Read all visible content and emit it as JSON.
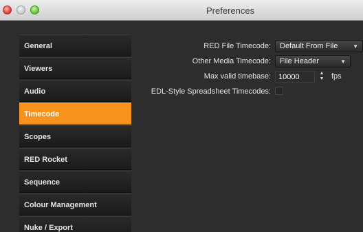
{
  "window": {
    "title": "Preferences"
  },
  "sidebar": {
    "items": [
      {
        "label": "General"
      },
      {
        "label": "Viewers"
      },
      {
        "label": "Audio"
      },
      {
        "label": "Timecode"
      },
      {
        "label": "Scopes"
      },
      {
        "label": "RED Rocket"
      },
      {
        "label": "Sequence"
      },
      {
        "label": "Colour Management"
      },
      {
        "label": "Nuke / Export"
      }
    ],
    "selected": "Timecode"
  },
  "timecode": {
    "red_file_timecode": {
      "label": "RED File Timecode:",
      "value": "Default From File"
    },
    "other_media_timecode": {
      "label": "Other Media Timecode:",
      "value": "File Header"
    },
    "max_valid_timebase": {
      "label": "Max valid timebase:",
      "value": "10000",
      "unit": "fps"
    },
    "edl_style": {
      "label": "EDL-Style Spreadsheet Timecodes:",
      "checked": false
    }
  },
  "colors": {
    "accent": "#f7931d",
    "background": "#2d2d2d"
  },
  "icons": {
    "popup": "chevron-down-icon",
    "stepper": "stepper-icon"
  }
}
